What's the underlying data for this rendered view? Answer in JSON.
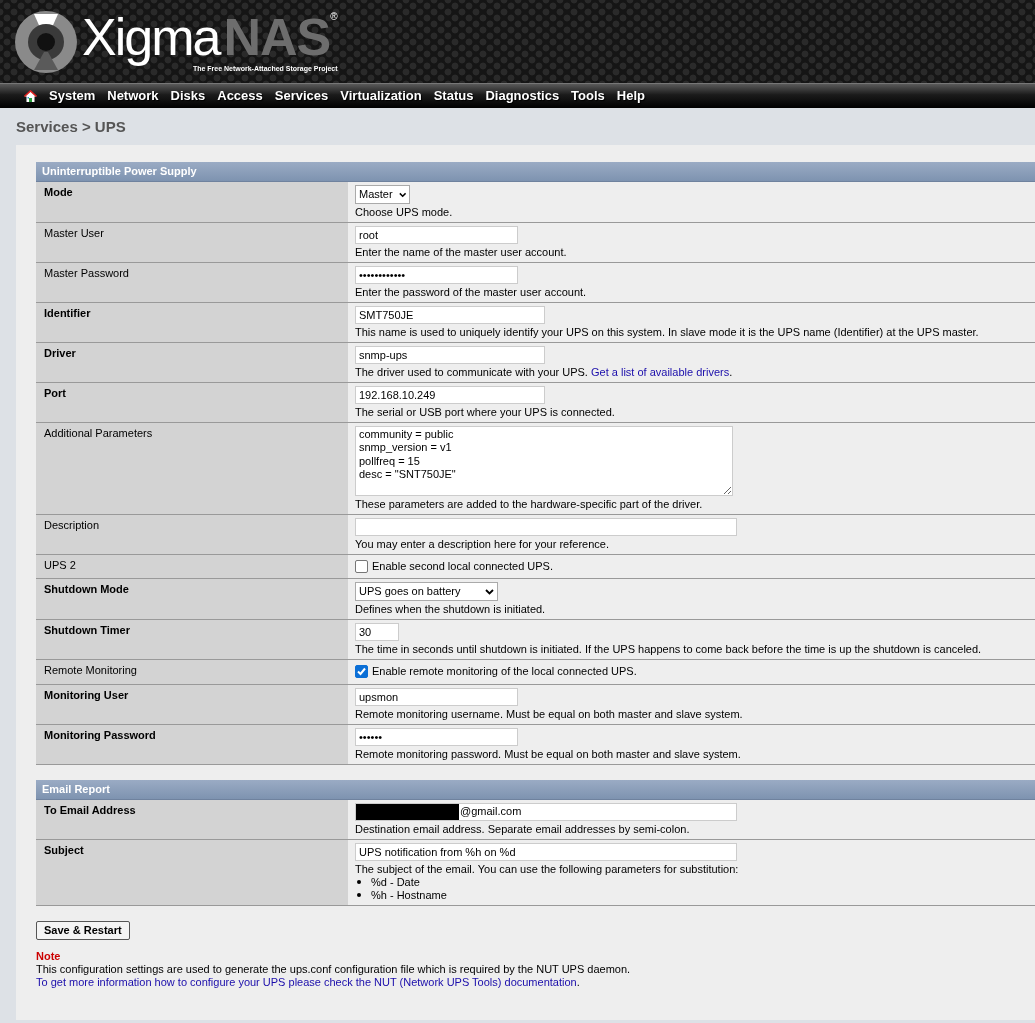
{
  "header": {
    "logo_text": "Xigma",
    "logo_text_bold": "NAS",
    "registered": "®",
    "tagline": "The Free Network-Attached Storage Project"
  },
  "nav": {
    "items": [
      "System",
      "Network",
      "Disks",
      "Access",
      "Services",
      "Virtualization",
      "Status",
      "Diagnostics",
      "Tools",
      "Help"
    ]
  },
  "breadcrumb": "Services > UPS",
  "sections": [
    {
      "title": "Uninterruptible Power Supply",
      "rows": [
        {
          "label": "Mode",
          "required": true,
          "kind": "select",
          "value": "Master",
          "help": "Choose UPS mode."
        },
        {
          "label": "Master User",
          "required": false,
          "kind": "text",
          "value": "root",
          "help": "Enter the name of the master user account."
        },
        {
          "label": "Master Password",
          "required": false,
          "kind": "text",
          "value": "••••••••••••",
          "help": "Enter the password of the master user account."
        },
        {
          "label": "Identifier",
          "required": true,
          "kind": "text",
          "value": "SMT750JE",
          "help": "This name is used to uniquely identify your UPS on this system. In slave mode it is the UPS name (Identifier) at the UPS master."
        },
        {
          "label": "Driver",
          "required": true,
          "kind": "text",
          "value": "snmp-ups",
          "help": "The driver used to communicate with your UPS. ",
          "help_link": "Get a list of available drivers",
          "help_after": "."
        },
        {
          "label": "Port",
          "required": true,
          "kind": "text",
          "value": "192.168.10.249",
          "help": "The serial or USB port where your UPS is connected."
        },
        {
          "label": "Additional Parameters",
          "required": false,
          "kind": "textarea",
          "value": "community = public\nsnmp_version = v1\npollfreq = 15\ndesc = \"SNT750JE\"",
          "help": "These parameters are added to the hardware-specific part of the driver."
        },
        {
          "label": "Description",
          "required": false,
          "kind": "text",
          "help": "You may enter a description here for your reference."
        },
        {
          "label": "UPS 2",
          "required": false,
          "kind": "checkbox",
          "checked": false,
          "text": "Enable second local connected UPS."
        },
        {
          "label": "Shutdown Mode",
          "required": true,
          "kind": "select",
          "value": "UPS goes on battery",
          "help": "Defines when the shutdown is initiated."
        },
        {
          "label": "Shutdown Timer",
          "required": true,
          "kind": "text",
          "value": "30",
          "help": "The time in seconds until shutdown is initiated. If the UPS happens to come back before the time is up the shutdown is canceled."
        },
        {
          "label": "Remote Monitoring",
          "required": false,
          "kind": "checkbox",
          "checked": true,
          "text": "Enable remote monitoring of the local connected UPS."
        },
        {
          "label": "Monitoring User",
          "required": true,
          "kind": "text",
          "value": "upsmon",
          "help": "Remote monitoring username. Must be equal on both master and slave system."
        },
        {
          "label": "Monitoring Password",
          "required": true,
          "kind": "text",
          "value": "••••••",
          "help": "Remote monitoring password. Must be equal on both master and slave system."
        }
      ]
    },
    {
      "title": "Email Report",
      "rows": [
        {
          "label": "To Email Address",
          "required": true,
          "kind": "text",
          "redacted": true,
          "value": "@gmail.com",
          "help": "Destination email address. Separate email addresses by semi-colon."
        },
        {
          "label": "Subject",
          "required": true,
          "kind": "text",
          "value": "UPS notification from %h on %d",
          "help": "The subject of the email. You can use the following parameters for substitution:",
          "help_items": [
            "%d - Date",
            "%h - Hostname"
          ]
        }
      ]
    }
  ],
  "save_button": "Save & Restart",
  "note": {
    "title": "Note",
    "text": "This configuration settings are used to generate the ups.conf configuration file which is required by the NUT UPS daemon.",
    "link": "To get more information how to configure your UPS please check the NUT (Network UPS Tools) documentation",
    "link_after": "."
  }
}
